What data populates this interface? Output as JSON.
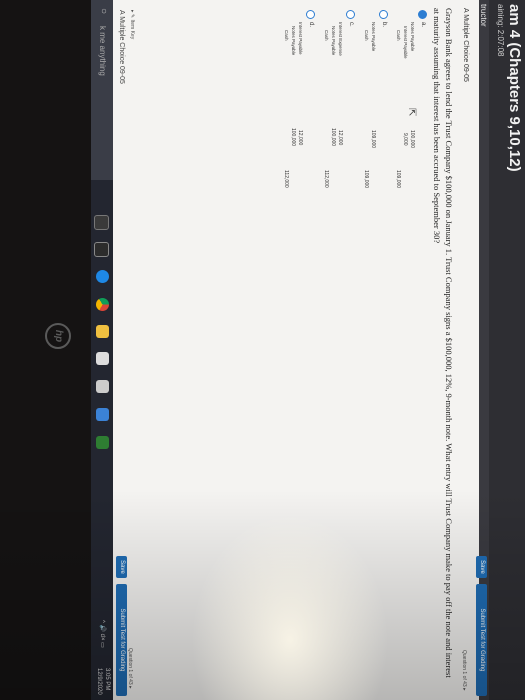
{
  "header": {
    "title": "am 4 (Chapters 9,10,12)",
    "remaining": "aining: 2:07:08",
    "instructor": "tructor"
  },
  "toolbar": {
    "save_label": "Save",
    "submit_label": "Submit Test for Grading",
    "question_count": "Question 1 of 43 ▸"
  },
  "question": {
    "heading": "A Multiple Choice 09-05",
    "text": "Grayson Bank agrees to lend the Trust Company $100,000 on January 1. Trust Company signs a $100,000, 12%, 9-month note. What entry will Trust Company make to pay off the note and interest at maturity assuming that interest has been accrued to September 30?",
    "options": [
      {
        "letter": "a.",
        "lines": [
          "Notes Payable",
          "Interest Payable",
          "Cash"
        ],
        "debits": [
          "100,000",
          "9,000"
        ],
        "credit": "109,000"
      },
      {
        "letter": "b.",
        "lines": [
          "Notes Payable",
          "Cash"
        ],
        "debits": [
          "109,000"
        ],
        "credit": "109,000"
      },
      {
        "letter": "c.",
        "lines": [
          "Interest Expense",
          "Notes Payable",
          "Cash"
        ],
        "debits": [
          "12,000",
          "100,000"
        ],
        "credit": "112,000"
      },
      {
        "letter": "d.",
        "lines": [
          "Interest Payable",
          "Notes Payable",
          "Cash"
        ],
        "debits": [
          "12,000",
          "100,000"
        ],
        "credit": "112,000"
      }
    ]
  },
  "footer": {
    "item_key": "▸ ✎ Item Key",
    "name": "A Multiple Choice 09-05",
    "count": "Question 1 of 43 ▸"
  },
  "taskbar": {
    "search_text": "k me anything",
    "time": "3:05 PM",
    "date": "12/9/2020",
    "tray": "^ 🔊 d× ▭"
  },
  "bezel": {
    "logo": "hp"
  },
  "colors": {
    "accent": "#1f6db5",
    "header_bg": "#2e2e33",
    "taskbar_bg": "#232630"
  }
}
